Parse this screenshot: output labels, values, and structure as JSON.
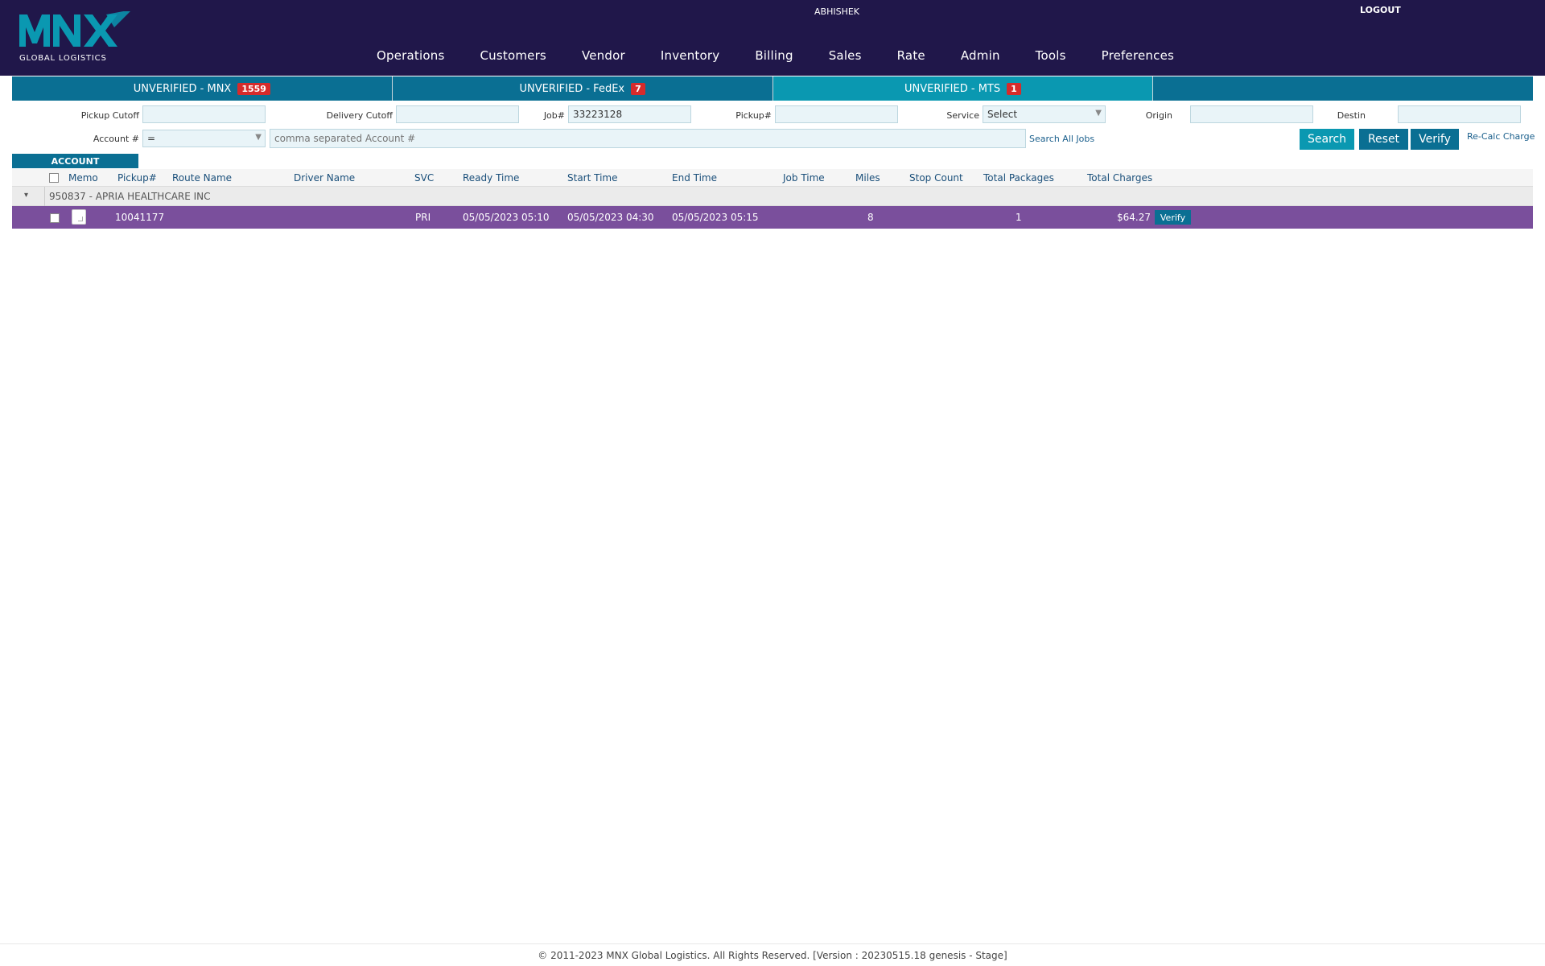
{
  "header": {
    "logo_text": "MNX",
    "logo_sub": "GLOBAL LOGISTICS",
    "user": "ABHISHEK",
    "logout": "LOGOUT",
    "brand_color": "#20174a",
    "accent_color": "#0a98b1"
  },
  "nav": [
    "Operations",
    "Customers",
    "Vendor",
    "Inventory",
    "Billing",
    "Sales",
    "Rate",
    "Admin",
    "Tools",
    "Preferences"
  ],
  "tabs": [
    {
      "label": "UNVERIFIED - MNX",
      "count": "1559",
      "active": false
    },
    {
      "label": "UNVERIFIED - FedEx",
      "count": "7",
      "active": false
    },
    {
      "label": "UNVERIFIED - MTS",
      "count": "1",
      "active": true
    },
    {
      "label": "",
      "count": "",
      "active": false
    }
  ],
  "filters": {
    "pickup_cutoff_label": "Pickup Cutoff",
    "pickup_cutoff_value": "",
    "delivery_cutoff_label": "Delivery Cutoff",
    "delivery_cutoff_value": "",
    "job_label": "Job#",
    "job_value": "33223128",
    "pickup_label": "Pickup#",
    "pickup_value": "",
    "service_label": "Service",
    "service_value": "Select",
    "origin_label": "Origin",
    "origin_value": "",
    "destin_label": "Destin",
    "destin_value": "",
    "account_label": "Account #",
    "account_operator": "=",
    "account_placeholder": "comma separated Account #",
    "search_all_jobs": "Search All Jobs",
    "search_button": "Search",
    "reset_button": "Reset",
    "verify_button": "Verify",
    "recalc_link": "Re-Calc Charge"
  },
  "grouping": {
    "label": "ACCOUNT"
  },
  "table": {
    "columns": [
      "Memo",
      "Pickup#",
      "Route Name",
      "Driver Name",
      "SVC",
      "Ready Time",
      "Start Time",
      "End Time",
      "Job Time",
      "Miles",
      "Stop Count",
      "Total Packages",
      "Total Charges"
    ],
    "group": "950837 - APRIA HEALTHCARE INC",
    "rows": [
      {
        "pickup": "10041177",
        "route_name": "",
        "driver_name": "",
        "svc": "PRI",
        "ready_time": "05/05/2023 05:10",
        "start_time": "05/05/2023 04:30",
        "end_time": "05/05/2023 05:15",
        "job_time": "",
        "miles": "8",
        "stop_count": "",
        "total_packages": "1",
        "total_charges": "$64.27",
        "action": "Verify",
        "row_color": "#7a4f9c"
      }
    ]
  },
  "footer": "© 2011-2023 MNX Global Logistics. All Rights Reserved. [Version : 20230515.18 genesis - Stage]"
}
